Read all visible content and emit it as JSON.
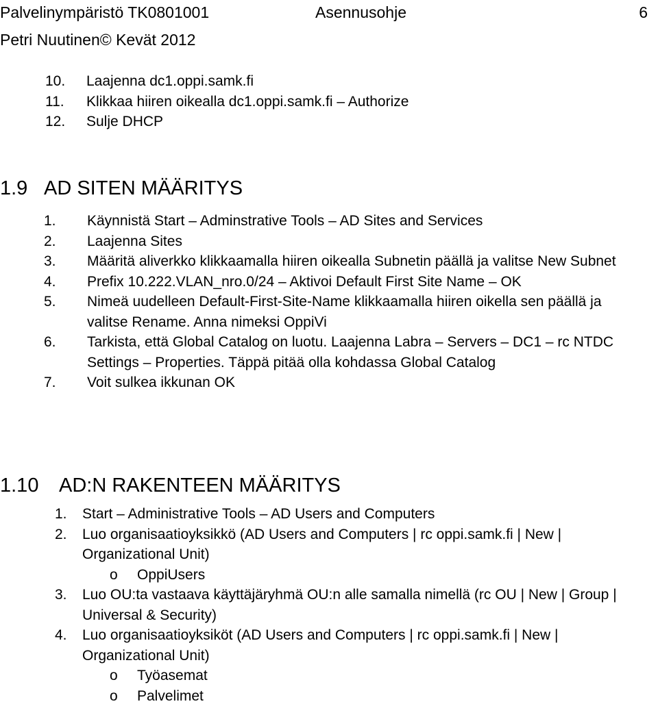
{
  "header": {
    "left": "Palvelinympäristö TK0801001",
    "center": "Asennusohje",
    "page_number": "6",
    "author_line": "Petri Nuutinen© Kevät 2012"
  },
  "continued_list": {
    "items": [
      {
        "number": "10.",
        "text": "Laajenna dc1.oppi.samk.fi"
      },
      {
        "number": "11.",
        "text": "Klikkaa hiiren oikealla dc1.oppi.samk.fi – Authorize"
      },
      {
        "number": "12.",
        "text": "Sulje DHCP"
      }
    ]
  },
  "section_1_9": {
    "number": "1.9",
    "title": "AD SITEN MÄÄRITYS",
    "items": [
      {
        "number": "1.",
        "text": "Käynnistä Start – Adminstrative Tools – AD Sites and Services"
      },
      {
        "number": "2.",
        "text": "Laajenna Sites"
      },
      {
        "number": "3.",
        "text": "Määritä aliverkko klikkaamalla hiiren oikealla Subnetin päällä ja valitse New Subnet"
      },
      {
        "number": "4.",
        "text": "Prefix 10.222.VLAN_nro.0/24 – Aktivoi Default First Site Name – OK"
      },
      {
        "number": "5.",
        "text": "Nimeä uudelleen Default-First-Site-Name klikkaamalla hiiren oikella sen päällä ja valitse Rename. Anna nimeksi OppiVi"
      },
      {
        "number": "6.",
        "text": "Tarkista, että Global Catalog on luotu. Laajenna Labra – Servers – DC1 – rc NTDC Settings – Properties. Täppä pitää olla kohdassa Global Catalog"
      },
      {
        "number": "7.",
        "text": "Voit sulkea ikkunan OK"
      }
    ]
  },
  "section_1_10": {
    "number": "1.10",
    "title": "AD:N RAKENTEEN MÄÄRITYS",
    "items": [
      {
        "number": "1.",
        "text": "Start – Administrative Tools – AD Users and Computers",
        "subitems": []
      },
      {
        "number": "2.",
        "text": "Luo organisaatioyksikkö (AD Users and Computers | rc oppi.samk.fi | New | Organizational Unit)",
        "subitems": [
          {
            "bullet": "o",
            "text": "OppiUsers"
          }
        ]
      },
      {
        "number": "3.",
        "text": "Luo OU:ta vastaava käyttäjäryhmä OU:n alle samalla nimellä (rc OU | New | Group | Universal & Security)",
        "subitems": []
      },
      {
        "number": "4.",
        "text": "Luo organisaatioyksiköt (AD Users and Computers | rc oppi.samk.fi | New | Organizational Unit)",
        "subitems": [
          {
            "bullet": "o",
            "text": "Työasemat"
          },
          {
            "bullet": "o",
            "text": "Palvelimet"
          }
        ]
      }
    ]
  }
}
